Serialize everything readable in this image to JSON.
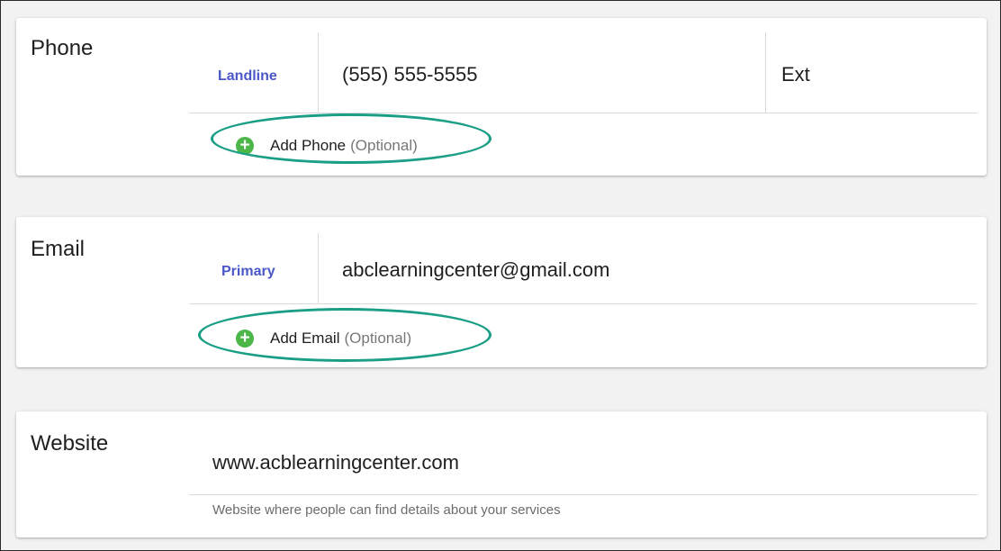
{
  "phone": {
    "label": "Phone",
    "type": "Landline",
    "number": "(555) 555-5555",
    "ext": "Ext",
    "add": {
      "label": "Add Phone",
      "optional": "(Optional)"
    }
  },
  "email": {
    "label": "Email",
    "type": "Primary",
    "address": "abclearningcenter@gmail.com",
    "add": {
      "label": "Add Email",
      "optional": "(Optional)"
    }
  },
  "website": {
    "label": "Website",
    "url": "www.acblearningcenter.com",
    "hint": "Website where people can find details about your services"
  },
  "icons": {
    "add": "plus-circle-icon",
    "plus_glyph": "+"
  },
  "colors": {
    "accent_label": "#4a57c8",
    "add_icon": "#4cb748",
    "highlight": "#1a9e86"
  }
}
